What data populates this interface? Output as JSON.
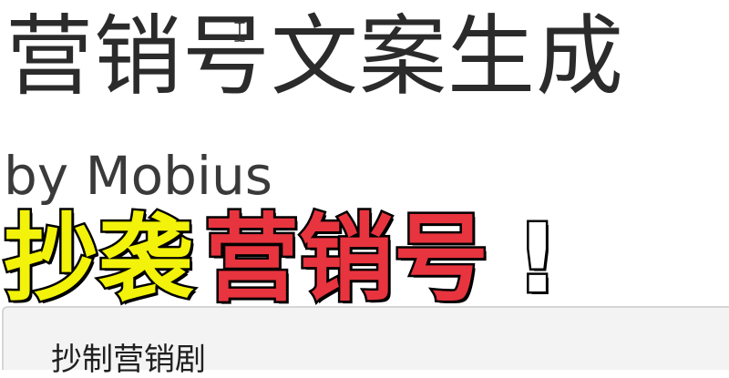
{
  "app": {
    "title": "营销号文案生成",
    "byline": "by Mobius"
  },
  "banner": {
    "part1": "抄袭",
    "part2": "营销号",
    "exclaim": "!",
    "colors": {
      "part1": "#f2f20a",
      "part2": "#e8343e",
      "outline": "#000000"
    }
  },
  "editor": {
    "value": "抄制营销剧",
    "cursor_icon": "text-cursor-icon"
  }
}
